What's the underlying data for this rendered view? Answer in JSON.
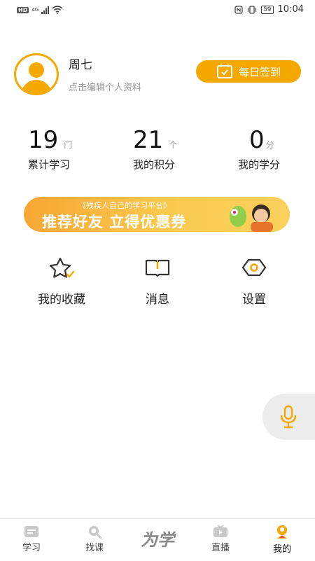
{
  "status_bar": {
    "hd": "HD",
    "network": "4G",
    "battery": "59",
    "time": "10:04"
  },
  "profile": {
    "name": "周七",
    "edit_hint": "点击编辑个人资料",
    "checkin_label": "每日签到"
  },
  "stats": [
    {
      "value": "19",
      "unit": "门",
      "label": "累计学习"
    },
    {
      "value": "21",
      "unit": "个",
      "label": "我的积分"
    },
    {
      "value": "0",
      "unit": "分",
      "label": "我的学分"
    }
  ],
  "banner": {
    "subtitle": "《残疾人自己的学习平台》",
    "title": "推荐好友  立得优惠券"
  },
  "features": [
    {
      "label": "我的收藏",
      "icon": "star-icon"
    },
    {
      "label": "消息",
      "icon": "message-book-icon"
    },
    {
      "label": "设置",
      "icon": "settings-hexagon-icon"
    }
  ],
  "tabbar": {
    "items": [
      {
        "label": "学习",
        "icon": "study-icon"
      },
      {
        "label": "找课",
        "icon": "search-icon"
      },
      {
        "label": "直播",
        "icon": "tv-icon"
      },
      {
        "label": "我的",
        "icon": "profile-icon"
      }
    ],
    "brand": "为学",
    "active": "我的"
  },
  "colors": {
    "accent": "#f5a800",
    "inactive": "#bbbbbb"
  }
}
